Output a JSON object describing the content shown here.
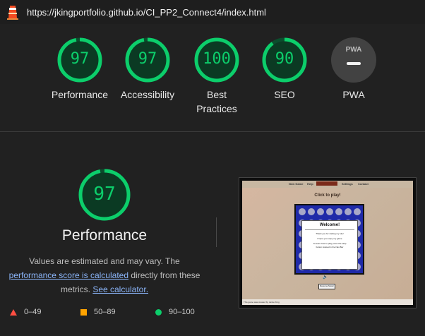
{
  "header": {
    "url": "https://jkingportfolio.github.io/CI_PP2_Connect4/index.html"
  },
  "gauges": [
    {
      "score": 97,
      "label": "Performance"
    },
    {
      "score": 97,
      "label": "Accessibility"
    },
    {
      "score": 100,
      "label_line1": "Best",
      "label_line2": "Practices"
    },
    {
      "score": 90,
      "label": "SEO"
    },
    {
      "badge": "PWA",
      "label": "PWA"
    }
  ],
  "performance": {
    "score": 97,
    "title": "Performance",
    "desc_part1": "Values are estimated and may vary. The",
    "desc_link1": "performance score is calculated",
    "desc_part2": "directly from these",
    "desc_part3": "metrics.",
    "desc_link2": "See calculator."
  },
  "legend": [
    {
      "range": "0–49",
      "color": "#ff4e42"
    },
    {
      "range": "50–89",
      "color": "#ffa400"
    },
    {
      "range": "90–100",
      "color": "#0cce6b"
    }
  ],
  "screenshot": {
    "nav_items": [
      "New Game",
      "Help",
      "Settings",
      "Contact"
    ],
    "heading": "Click to play!",
    "modal_title": "Welcome!",
    "modal_line1": "Thank you for visiting my site!",
    "modal_line2": "I hope you enjoy my game",
    "modal_line3": "To learn how to play press the Help",
    "modal_line4": "button located in the Nav Bar",
    "button_label": "Resume Music",
    "footer_text": "This game was created by Jamie King"
  },
  "colors": {
    "pass": "#0cce6b",
    "pass_track": "#0b3a23",
    "background": "#212121"
  }
}
